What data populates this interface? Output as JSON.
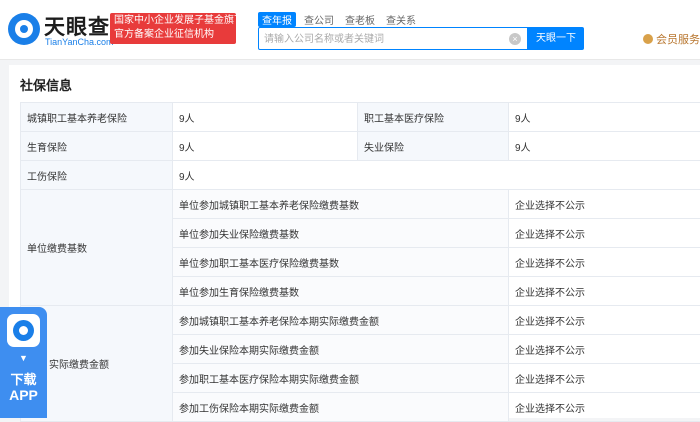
{
  "header": {
    "logo_cn": "天眼查",
    "logo_en": "TianYanCha.com",
    "badge_line1": "国家中小企业发展子基金旗下",
    "badge_line2": "官方备案企业征信机构",
    "tabs": [
      "查年报",
      "查公司",
      "查老板",
      "查关系"
    ],
    "search_placeholder": "请输入公司名称或者关键词",
    "search_button": "天眼一下",
    "vip_label": "会员服务"
  },
  "section": {
    "title": "社保信息"
  },
  "insurance": {
    "pension_label": "城镇职工基本养老保险",
    "pension_value": "9人",
    "medical_label": "职工基本医疗保险",
    "medical_value": "9人",
    "maternity_label": "生育保险",
    "maternity_value": "9人",
    "unemployment_label": "失业保险",
    "unemployment_value": "9人",
    "injury_label": "工伤保险",
    "injury_value": "9人"
  },
  "base": {
    "group_label": "单位缴费基数",
    "rows": [
      {
        "label": "单位参加城镇职工基本养老保险缴费基数",
        "value": "企业选择不公示"
      },
      {
        "label": "单位参加失业保险缴费基数",
        "value": "企业选择不公示"
      },
      {
        "label": "单位参加职工基本医疗保险缴费基数",
        "value": "企业选择不公示"
      },
      {
        "label": "单位参加生育保险缴费基数",
        "value": "企业选择不公示"
      }
    ]
  },
  "actual": {
    "group_label": "实际缴费金额",
    "rows": [
      {
        "label": "参加城镇职工基本养老保险本期实际缴费金额",
        "value": "企业选择不公示"
      },
      {
        "label": "参加失业保险本期实际缴费金额",
        "value": "企业选择不公示"
      },
      {
        "label": "参加职工基本医疗保险本期实际缴费金额",
        "value": "企业选择不公示"
      },
      {
        "label": "参加工伤保险本期实际缴费金额",
        "value": "企业选择不公示"
      }
    ]
  },
  "app_float": {
    "line1": "下载",
    "line2": "APP"
  }
}
